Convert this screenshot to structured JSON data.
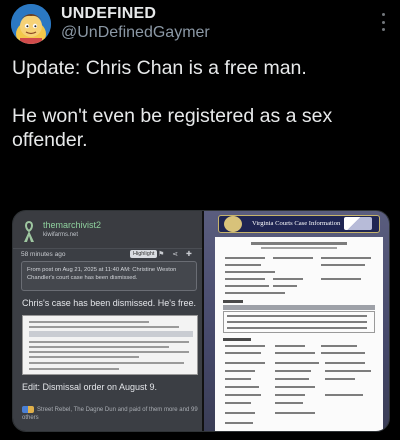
{
  "author": {
    "display_name": "UNDEFINED",
    "handle": "@UnDefinedGaymer",
    "avatar": "avatar-cartoon-icon"
  },
  "post": {
    "paragraphs": [
      "Update: Chris Chan is a free man.",
      "He won't even be registered as a sex offender."
    ]
  },
  "media": {
    "forum": {
      "username": "themarchivist2",
      "site": "kiwifarms.net",
      "time": "58 minutes ago",
      "tag": "Highlight",
      "quote": "From post on Aug 21, 2025 at 11:40 AM: Christine Weston Chandler's court case has been dismissed.",
      "line1": "Chris's case has been dismissed. He's free.",
      "line2": "Edit: Dismissal order on August 9.",
      "footer": "Street Rebel, The Dagne Dun and paid of them more and 99 others"
    },
    "court": {
      "title": "Virginia Courts Case Information"
    }
  },
  "colors": {
    "background": "#000000",
    "text": "#e7e9ea",
    "muted": "#8b98a5",
    "forum_green": "#8fd19e"
  }
}
